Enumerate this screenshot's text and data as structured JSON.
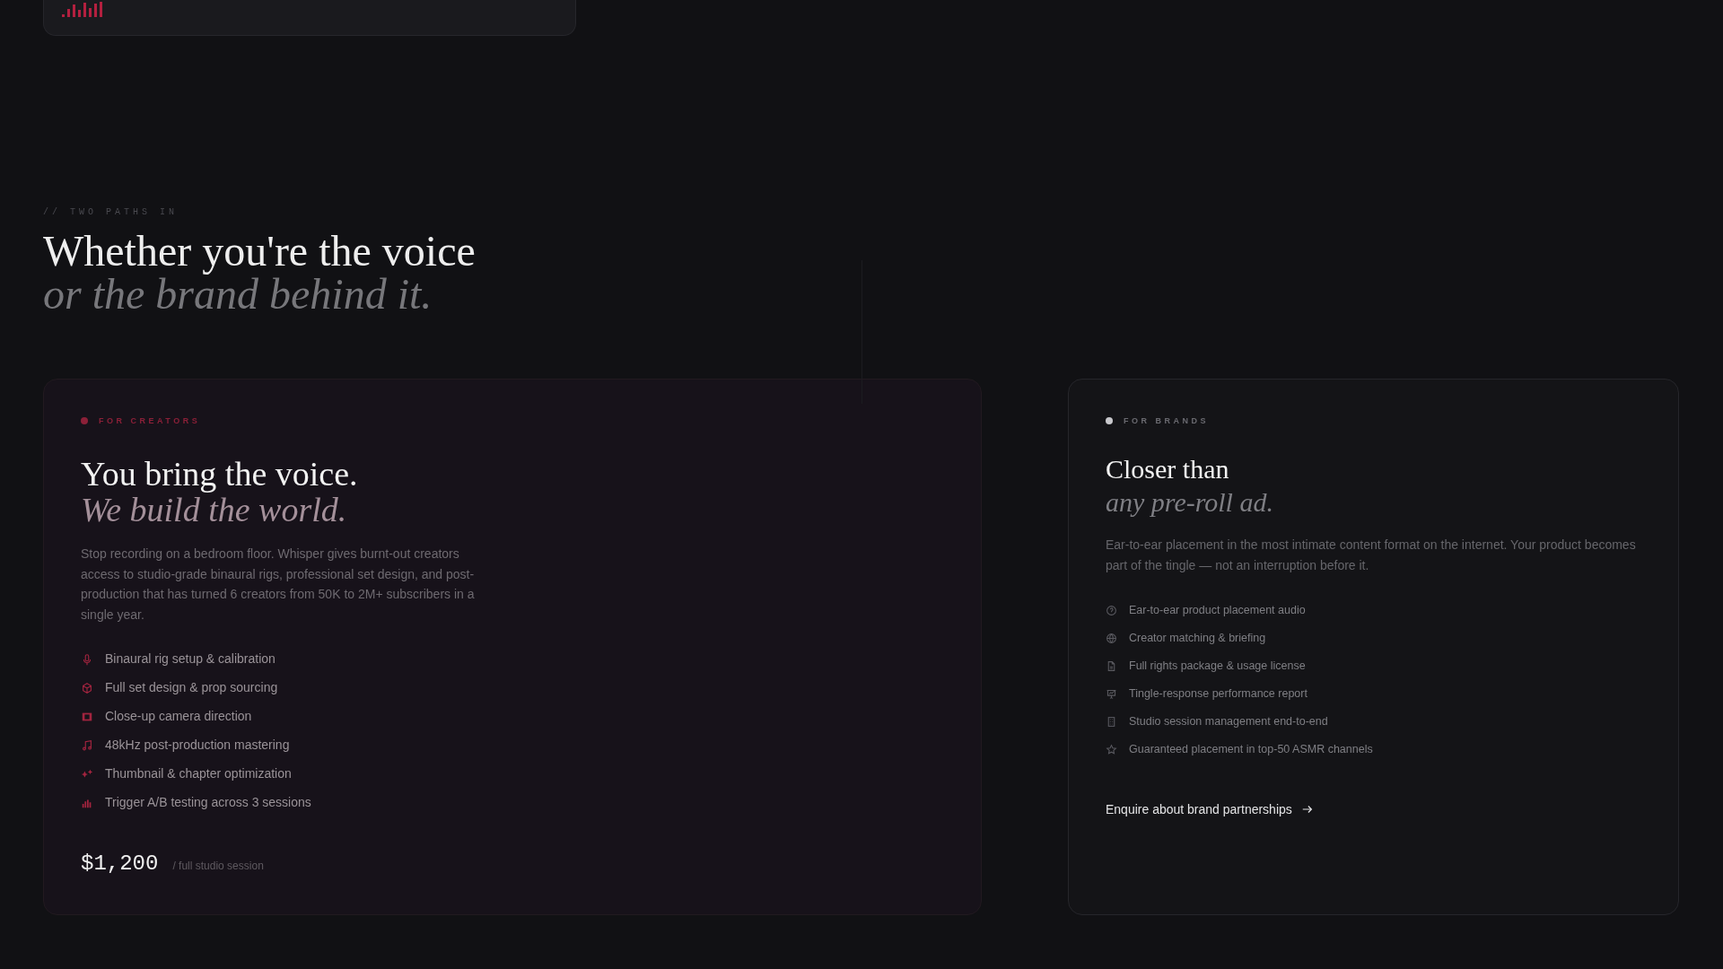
{
  "top_card": {
    "kind": "waveform"
  },
  "eyebrow": "// TWO PATHS IN",
  "heading": {
    "line1": "Whether you're the voice",
    "line2": "or the brand behind it."
  },
  "cards": [
    {
      "kind": "creators",
      "label": "FOR CREATORS",
      "title": "You bring the voice.",
      "subtitle": "We build the world.",
      "description": "Stop recording on a bedroom floor. Whisper gives burnt-out creators access to studio-grade binaural rigs, professional set design, and post-production that has turned 6 creators from 50K to 2M+ subscribers in a single year.",
      "features": [
        {
          "text": "Binaural rig setup & calibration"
        },
        {
          "text": "Full set design & prop sourcing"
        },
        {
          "text": "Close-up camera direction"
        },
        {
          "text": "48kHz post-production mastering"
        },
        {
          "text": "Thumbnail & chapter optimization"
        },
        {
          "text": "Trigger A/B testing across 3 sessions"
        }
      ],
      "price": "$1,200",
      "price_note": "/ full studio session"
    },
    {
      "kind": "brands",
      "label": "FOR BRANDS",
      "title": "Closer than",
      "subtitle": "any pre-roll ad.",
      "description": "Ear-to-ear placement in the most intimate content format on the internet. Your product becomes part of the tingle — not an interruption before it.",
      "features": [
        {
          "text": "Ear-to-ear product placement audio"
        },
        {
          "text": "Creator matching & briefing"
        },
        {
          "text": "Full rights package & usage license"
        },
        {
          "text": "Tingle-response performance report"
        },
        {
          "text": "Studio session management end-to-end"
        },
        {
          "text": "Guaranteed placement in top-50 ASMR channels"
        }
      ],
      "link": "Enquire about brand partnerships"
    }
  ]
}
